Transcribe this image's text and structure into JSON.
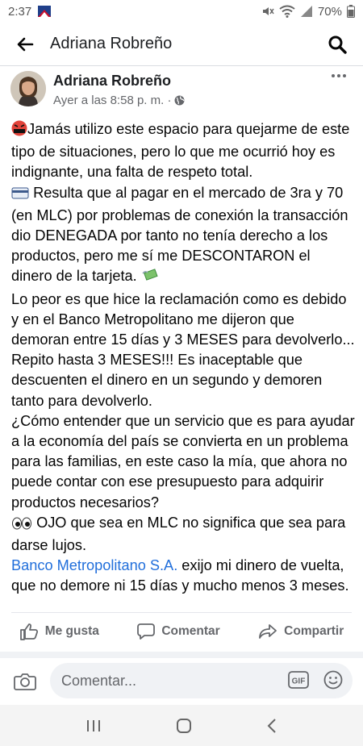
{
  "status_bar": {
    "time": "2:37",
    "battery": "70%"
  },
  "header": {
    "title": "Adriana Robreño"
  },
  "post": {
    "author": "Adriana Robreño",
    "timestamp": "Ayer a las 8:58 p. m. ·",
    "paragraphs": [
      "Jamás utilizo este espacio para quejarme de este tipo de situaciones, pero lo que me ocurrió hoy es indignante, una falta de respeto total.",
      "Resulta que al pagar en el mercado de 3ra y 70 (en MLC) por problemas de conexión la transacción dio DENEGADA por tanto no tenía derecho a los productos, pero me sí me DESCONTARON el dinero de la tarjeta.",
      "Lo peor es que hice la reclamación como es debido y en el Banco Metropolitano me dijeron que demoran entre 15 días y 3 MESES para devolverlo... Repito hasta 3 MESES!!! Es inaceptable que descuenten el dinero en un segundo y demoren tanto para devolverlo.",
      "¿Cómo entender que un servicio que es para ayudar a la economía del país se convierta en un problema para las familias, en este caso la mía, que ahora no puede contar con ese presupuesto para adquirir productos necesarios?",
      "OJO que sea en MLC no significa que sea para darse lujos."
    ],
    "mention": "Banco Metropolitano S.A.",
    "closing": " exijo mi dinero de vuelta, que no demore ni 15 días y mucho menos 3 meses."
  },
  "actions": {
    "like": "Me gusta",
    "comment": "Comentar",
    "share": "Compartir"
  },
  "comment_bar": {
    "placeholder": "Comentar..."
  },
  "icons": [
    "back-arrow-icon",
    "search-icon",
    "more-options-icon",
    "globe-icon",
    "like-icon",
    "comment-icon",
    "share-icon",
    "camera-icon",
    "gif-icon",
    "emoji-icon"
  ],
  "colors": {
    "link": "#216fdb",
    "secondary_text": "#65676b",
    "text": "#050505"
  }
}
